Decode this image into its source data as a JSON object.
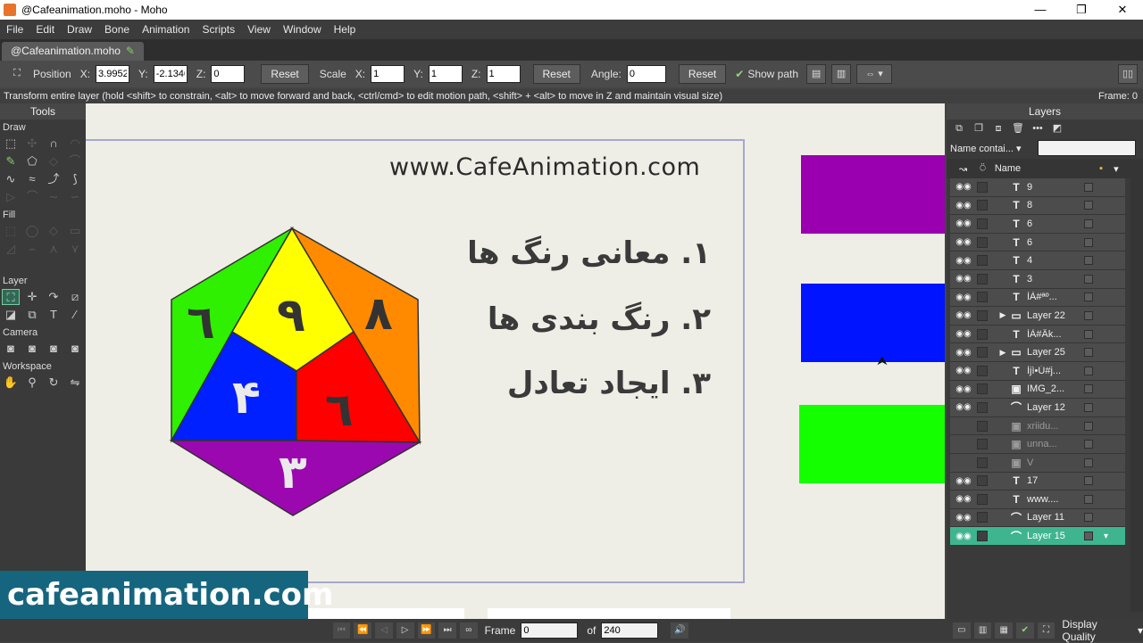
{
  "window": {
    "title": "@Cafeanimation.moho - Moho",
    "controls": [
      "—",
      "❐",
      "✕"
    ]
  },
  "menu": [
    "File",
    "Edit",
    "Draw",
    "Bone",
    "Animation",
    "Scripts",
    "View",
    "Window",
    "Help"
  ],
  "document_tab": "@Cafeanimation.moho",
  "tool_options": {
    "position_label": "Position",
    "x_label": "X:",
    "x_value": "3.9952",
    "y_label": "Y:",
    "y_value": "-2.1346",
    "z_label": "Z:",
    "z_value": "0",
    "reset": "Reset",
    "scale_label": "Scale",
    "sx": "1",
    "sy": "1",
    "sz": "1",
    "angle_label": "Angle:",
    "angle_value": "0",
    "show_path": "Show path"
  },
  "hint": "Transform entire layer (hold <shift> to constrain, <alt> to move forward and back, <ctrl/cmd> to edit motion path, <shift> + <alt> to move in Z and maintain visual size)",
  "frame_status": "Frame: 0",
  "tools": {
    "title": "Tools",
    "sections": [
      "Draw",
      "Fill",
      "Layer",
      "Camera",
      "Workspace"
    ]
  },
  "canvas": {
    "url_text": "www.CafeAnimation.com",
    "farsi_lines": [
      "۱. معانی رنگ ها",
      "۲. رنگ بندی ها",
      "۳. ایجاد تعادل"
    ],
    "shape_labels": {
      "nine": "۹",
      "eight": "۸",
      "six_left": "٦",
      "four": "۴",
      "six_red": "٦",
      "three": "۳"
    },
    "colors": {
      "purple": "#9a00b0",
      "blue": "#0014ff",
      "green": "#14ff00",
      "yellow": "#ffff00",
      "orange": "#ff8a00",
      "red": "#ff0000",
      "die_purple": "#9c08b0",
      "die_blue": "#0020ff",
      "die_green": "#2ef000"
    }
  },
  "watermark": "cafeanimation.com",
  "layers": {
    "title": "Layers",
    "filter_label": "Name contai...",
    "name_header": "Name",
    "rows": [
      {
        "icon": "T",
        "name": "9"
      },
      {
        "icon": "T",
        "name": "8"
      },
      {
        "icon": "T",
        "name": "6"
      },
      {
        "icon": "T",
        "name": "6"
      },
      {
        "icon": "T",
        "name": "4"
      },
      {
        "icon": "T",
        "name": "3"
      },
      {
        "icon": "T",
        "name": "ÌÀ#ªº..."
      },
      {
        "icon": "▭",
        "name": "Layer 22",
        "expand": "▶"
      },
      {
        "icon": "T",
        "name": "ÌÀ#Âk..."
      },
      {
        "icon": "▭",
        "name": "Layer 25",
        "expand": "▶"
      },
      {
        "icon": "T",
        "name": "Ìjì•Ú#j..."
      },
      {
        "icon": "▣",
        "name": "IMG_2..."
      },
      {
        "icon": "⌒",
        "name": "Layer 12"
      },
      {
        "icon": "▣",
        "name": "xriidu...",
        "dim": true
      },
      {
        "icon": "▣",
        "name": "unna...",
        "dim": true
      },
      {
        "icon": "▣",
        "name": "V",
        "dim": true
      },
      {
        "icon": "T",
        "name": "17"
      },
      {
        "icon": "T",
        "name": "www...."
      },
      {
        "icon": "⌒",
        "name": "Layer 11"
      },
      {
        "icon": "⌒",
        "name": "Layer 15",
        "selected": true
      }
    ]
  },
  "timeline": {
    "frame_label": "Frame",
    "frame_value": "0",
    "of_label": "of",
    "of_value": "240",
    "display_quality": "Display Quality"
  }
}
